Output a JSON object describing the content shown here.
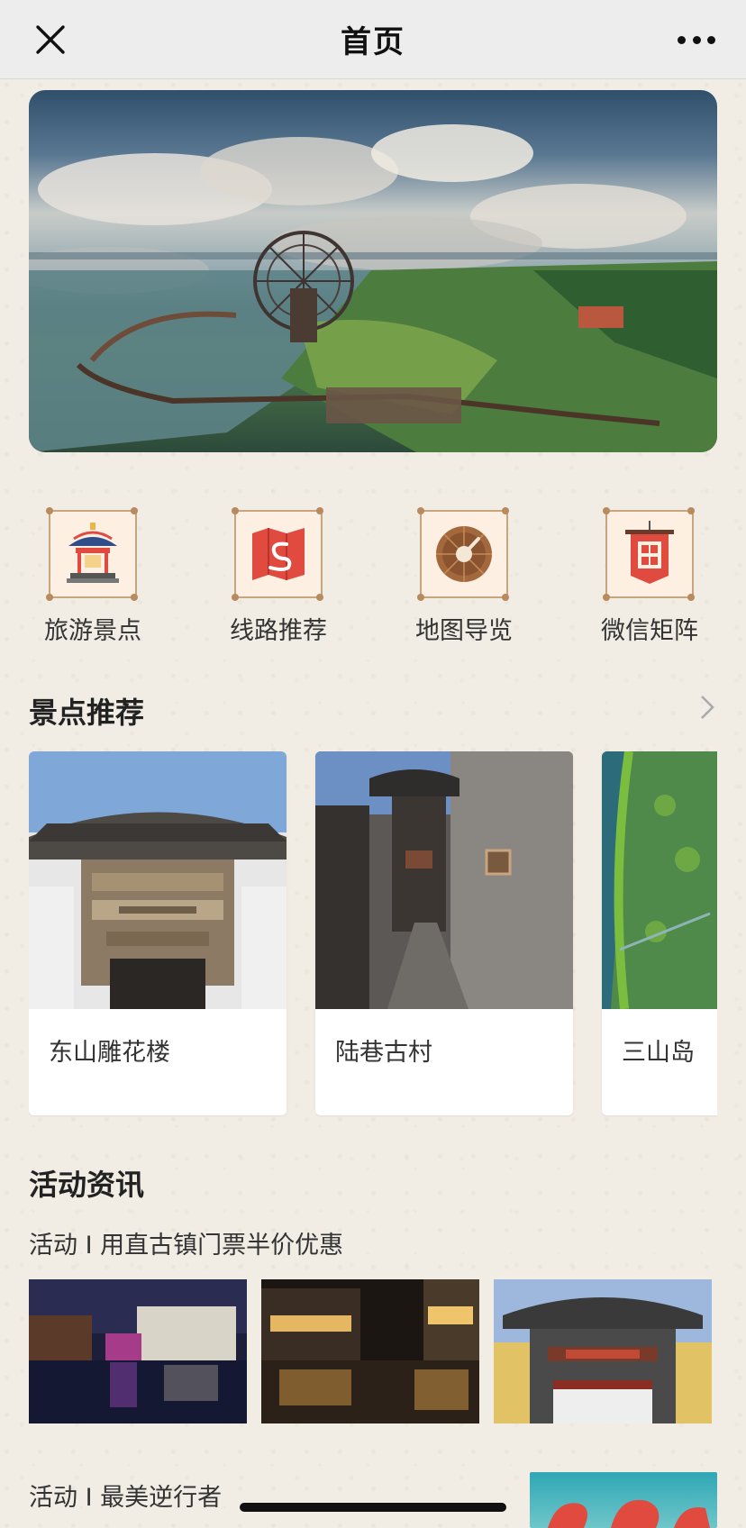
{
  "nav": {
    "title": "首页",
    "close_icon": "close-icon",
    "more_icon": "more-dots-icon"
  },
  "banner": {
    "image": "lake-waterwheel-landscape"
  },
  "quick_links": [
    {
      "label": "旅游景点",
      "icon": "pavilion-icon"
    },
    {
      "label": "线路推荐",
      "icon": "route-map-icon"
    },
    {
      "label": "地图导览",
      "icon": "compass-icon"
    },
    {
      "label": "微信矩阵",
      "icon": "window-banner-icon"
    }
  ],
  "recommend": {
    "title": "景点推荐",
    "more_icon": "chevron-right-icon",
    "cards": [
      {
        "name": "东山雕花楼",
        "image": "carved-gate-building"
      },
      {
        "name": "陆巷古村",
        "image": "ancient-village-alley"
      },
      {
        "name": "三山岛",
        "image": "island-aerial-view"
      }
    ]
  },
  "news": {
    "title": "活动资讯",
    "item1": {
      "title": "活动 I 用直古镇门票半价优惠"
    },
    "item2": {
      "title": "活动 I 最美逆行者"
    }
  },
  "colors": {
    "background": "#f1ede4",
    "nav_bg": "#ededed",
    "icon_red": "#e04a3f",
    "icon_border": "#c9a57f"
  }
}
